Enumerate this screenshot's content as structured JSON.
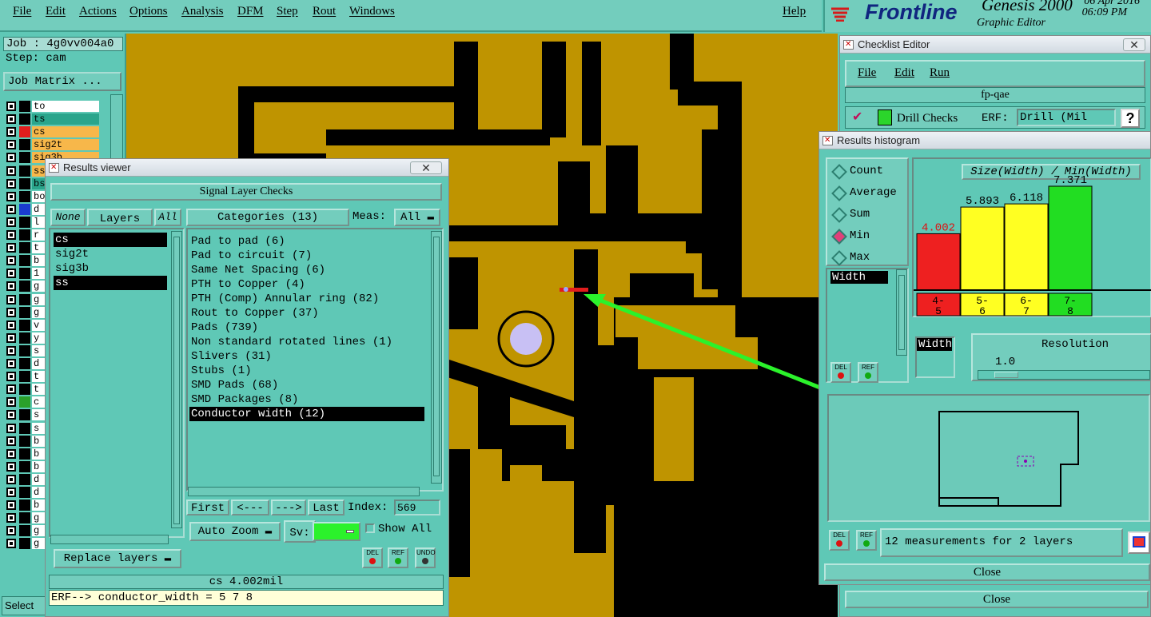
{
  "menubar": {
    "items": [
      "File",
      "Edit",
      "Actions",
      "Options",
      "Analysis",
      "DFM",
      "Step",
      "Rout",
      "Windows"
    ],
    "help": "Help"
  },
  "brand": {
    "logo": "Frontline",
    "product": "Genesis 2000",
    "subtitle": "Graphic Editor",
    "date": "06 Apr 2016",
    "time": "06:09 PM"
  },
  "left_panel": {
    "job_label": "Job : 4g0vv004a0",
    "step_label": "Step: cam",
    "job_matrix_button": "Job Matrix ...",
    "layers": [
      {
        "name": "to",
        "color": "#ffffff",
        "swatch": "#000000"
      },
      {
        "name": "ts",
        "color": "#2aa58c",
        "swatch": "#000000"
      },
      {
        "name": "cs",
        "color": "#f7b74a",
        "swatch": "#e11d1d"
      },
      {
        "name": "sig2t",
        "color": "#f7b74a",
        "swatch": "#000000"
      },
      {
        "name": "sig3b",
        "color": "#f7b74a",
        "swatch": "#000000"
      },
      {
        "name": "ss",
        "color": "#f7b74a",
        "swatch": "#000000"
      },
      {
        "name": "bs",
        "color": "#2aa58c",
        "swatch": "#000000"
      },
      {
        "name": "bo",
        "color": "#ffffff",
        "swatch": "#000000"
      },
      {
        "name": "d",
        "color": "#ffffff",
        "swatch": "#1a3ccf"
      },
      {
        "name": "l",
        "color": "#ffffff",
        "swatch": "#000000"
      },
      {
        "name": "r",
        "color": "#ffffff",
        "swatch": "#000000"
      },
      {
        "name": "t",
        "color": "#ffffff",
        "swatch": "#000000"
      },
      {
        "name": "b",
        "color": "#ffffff",
        "swatch": "#000000"
      },
      {
        "name": "1",
        "color": "#ffffff",
        "swatch": "#000000"
      },
      {
        "name": "g",
        "color": "#ffffff",
        "swatch": "#000000"
      },
      {
        "name": "g",
        "color": "#ffffff",
        "swatch": "#000000"
      },
      {
        "name": "g",
        "color": "#ffffff",
        "swatch": "#000000"
      },
      {
        "name": "v",
        "color": "#ffffff",
        "swatch": "#000000"
      },
      {
        "name": "y",
        "color": "#ffffff",
        "swatch": "#000000"
      },
      {
        "name": "s",
        "color": "#ffffff",
        "swatch": "#000000"
      },
      {
        "name": "d",
        "color": "#ffffff",
        "swatch": "#000000"
      },
      {
        "name": "t",
        "color": "#ffffff",
        "swatch": "#000000"
      },
      {
        "name": "t",
        "color": "#ffffff",
        "swatch": "#000000"
      },
      {
        "name": "c",
        "color": "#ffffff",
        "swatch": "#2aa02a"
      },
      {
        "name": "s",
        "color": "#ffffff",
        "swatch": "#000000"
      },
      {
        "name": "s",
        "color": "#ffffff",
        "swatch": "#000000"
      },
      {
        "name": "b",
        "color": "#ffffff",
        "swatch": "#000000"
      },
      {
        "name": "b",
        "color": "#ffffff",
        "swatch": "#000000"
      },
      {
        "name": "b",
        "color": "#ffffff",
        "swatch": "#000000"
      },
      {
        "name": "d",
        "color": "#ffffff",
        "swatch": "#000000"
      },
      {
        "name": "d",
        "color": "#ffffff",
        "swatch": "#000000"
      },
      {
        "name": "b",
        "color": "#ffffff",
        "swatch": "#000000"
      },
      {
        "name": "g",
        "color": "#ffffff",
        "swatch": "#000000"
      },
      {
        "name": "g",
        "color": "#ffffff",
        "swatch": "#000000"
      },
      {
        "name": "g",
        "color": "#ffffff",
        "swatch": "#000000"
      }
    ],
    "select_label": "Select"
  },
  "results_viewer": {
    "title": "Results viewer",
    "header": "Signal Layer Checks",
    "none_btn": "None",
    "layers_label": "Layers",
    "all_btn": "All",
    "categories_label": "Categories (13)",
    "meas_label": "Meas:",
    "meas_value": "All",
    "layer_items": [
      {
        "name": "cs",
        "selected": true
      },
      {
        "name": "sig2t",
        "selected": false
      },
      {
        "name": "sig3b",
        "selected": false
      },
      {
        "name": "ss",
        "selected": true
      }
    ],
    "categories": [
      {
        "name": "Pad to pad (6)",
        "selected": false
      },
      {
        "name": "Pad to circuit (7)",
        "selected": false
      },
      {
        "name": "Same Net Spacing (6)",
        "selected": false
      },
      {
        "name": "PTH to Copper (4)",
        "selected": false
      },
      {
        "name": "PTH (Comp) Annular ring (82)",
        "selected": false
      },
      {
        "name": "Rout to Copper (37)",
        "selected": false
      },
      {
        "name": "Pads (739)",
        "selected": false
      },
      {
        "name": "Non standard rotated lines (1)",
        "selected": false
      },
      {
        "name": "Slivers (31)",
        "selected": false
      },
      {
        "name": "Stubs (1)",
        "selected": false
      },
      {
        "name": "SMD Pads (68)",
        "selected": false
      },
      {
        "name": "SMD Packages (8)",
        "selected": false
      },
      {
        "name": "Conductor width (12)",
        "selected": true
      }
    ],
    "nav": {
      "first": "First",
      "prev": "<---",
      "next": "--->",
      "last": "Last",
      "index_label": "Index:",
      "index_value": "569"
    },
    "auto_zoom": "Auto Zoom",
    "sv_label": "Sv:",
    "show_all": "Show All",
    "replace_layers": "Replace layers",
    "status": "cs 4.002mil",
    "erf_line": "ERF--> conductor_width = 5 7 8",
    "del_btn": "DEL",
    "ref_btn": "REF",
    "undo_btn": "UNDO"
  },
  "checklist_editor": {
    "title": "Checklist Editor",
    "menu": [
      "File",
      "Edit",
      "Run"
    ],
    "checklist_name": "fp-qae",
    "row_label": "Drill Checks",
    "erf_label": "ERF:",
    "erf_value": "Drill (Mil",
    "help_icon": "?",
    "close": "Close"
  },
  "results_histogram": {
    "title": "Results histogram",
    "options": [
      {
        "label": "Count",
        "selected": false
      },
      {
        "label": "Average",
        "selected": false
      },
      {
        "label": "Sum",
        "selected": false
      },
      {
        "label": "Min",
        "selected": true
      },
      {
        "label": "Max",
        "selected": false
      }
    ],
    "meas_item": "Width",
    "chart_title": "Size(Width) / Min(Width)",
    "width_label": "Width",
    "resolution_label": "Resolution",
    "resolution_value": "1.0",
    "summary": "12 measurements for 2 layers",
    "close": "Close",
    "del_btn": "DEL",
    "ref_btn": "REF"
  },
  "chart_data": {
    "type": "bar",
    "title": "Size(Width) / Min(Width)",
    "categories": [
      "4-5",
      "5-6",
      "6-7",
      "7-8"
    ],
    "values": [
      4.002,
      5.893,
      6.118,
      7.371
    ],
    "colors": [
      "#ee2020",
      "#ffff22",
      "#ffff22",
      "#22dd22"
    ],
    "value_label_colors": [
      "#dd1111",
      "#000000",
      "#000000",
      "#000000"
    ]
  },
  "colors": {
    "panel": "#5fc8b6",
    "copper": "#bf9400",
    "background": "#000000",
    "arrow": "#2bf22b"
  }
}
